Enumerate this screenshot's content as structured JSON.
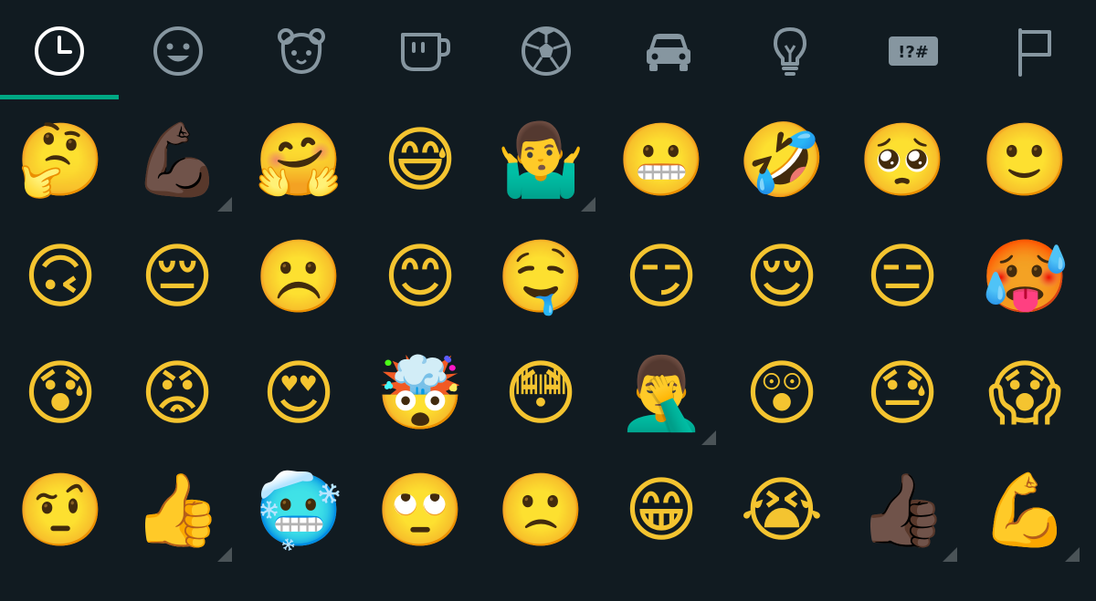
{
  "colors": {
    "background": "#111b21",
    "icon": "#8696a0",
    "accent": "#00a884"
  },
  "tabs": [
    {
      "icon": "clock-icon",
      "name": "recent",
      "active": true
    },
    {
      "icon": "smiley-icon",
      "name": "smileys-people",
      "active": false
    },
    {
      "icon": "bear-icon",
      "name": "animals-nature",
      "active": false
    },
    {
      "icon": "cup-icon",
      "name": "food-drink",
      "active": false
    },
    {
      "icon": "soccer-ball-icon",
      "name": "activity",
      "active": false
    },
    {
      "icon": "car-icon",
      "name": "travel-places",
      "active": false
    },
    {
      "icon": "lightbulb-icon",
      "name": "objects",
      "active": false
    },
    {
      "icon": "symbols-icon",
      "name": "symbols",
      "active": false,
      "label": "!?#"
    },
    {
      "icon": "flag-icon",
      "name": "flags",
      "active": false
    }
  ],
  "emoji_rows": [
    [
      {
        "char": "🤔",
        "name": "thinking-face",
        "variant": false
      },
      {
        "char": "💪🏿",
        "name": "flexed-biceps-dark",
        "variant": true
      },
      {
        "char": "🤗",
        "name": "hugging-face",
        "variant": false
      },
      {
        "char": "😅",
        "name": "grinning-face-with-sweat",
        "variant": false
      },
      {
        "char": "🤷‍♂️",
        "name": "man-shrugging",
        "variant": true
      },
      {
        "char": "😬",
        "name": "grimacing-face",
        "variant": false
      },
      {
        "char": "🤣",
        "name": "rolling-on-floor-laughing",
        "variant": false
      },
      {
        "char": "🥺",
        "name": "pleading-face",
        "variant": false
      },
      {
        "char": "🙂",
        "name": "slightly-smiling-face",
        "variant": false
      }
    ],
    [
      {
        "char": "🙃",
        "name": "upside-down-face",
        "variant": false
      },
      {
        "char": "😔",
        "name": "pensive-face",
        "variant": false
      },
      {
        "char": "☹️",
        "name": "frowning-face",
        "variant": false
      },
      {
        "char": "😊",
        "name": "smiling-face-with-smiling-eyes",
        "variant": false
      },
      {
        "char": "🤤",
        "name": "drooling-face",
        "variant": false
      },
      {
        "char": "😏",
        "name": "smirking-face",
        "variant": false
      },
      {
        "char": "😌",
        "name": "relieved-face",
        "variant": false
      },
      {
        "char": "😑",
        "name": "expressionless-face",
        "variant": false
      },
      {
        "char": "🥵",
        "name": "hot-face",
        "variant": false
      }
    ],
    [
      {
        "char": "😰",
        "name": "anxious-face-with-sweat",
        "variant": false
      },
      {
        "char": "😡",
        "name": "pouting-face",
        "variant": false
      },
      {
        "char": "😍",
        "name": "smiling-face-with-heart-eyes",
        "variant": false
      },
      {
        "char": "🤯",
        "name": "exploding-head",
        "variant": false
      },
      {
        "char": "😳",
        "name": "flushed-face",
        "variant": false
      },
      {
        "char": "🤦‍♂️",
        "name": "man-facepalming",
        "variant": true
      },
      {
        "char": "😲",
        "name": "astonished-face",
        "variant": false
      },
      {
        "char": "😓",
        "name": "downcast-face-with-sweat",
        "variant": false
      },
      {
        "char": "😱",
        "name": "face-screaming-in-fear",
        "variant": false
      }
    ],
    [
      {
        "char": "🤨",
        "name": "face-with-raised-eyebrow",
        "variant": false
      },
      {
        "char": "👍",
        "name": "thumbs-up",
        "variant": true
      },
      {
        "char": "🥶",
        "name": "cold-face",
        "variant": false
      },
      {
        "char": "🙄",
        "name": "face-with-rolling-eyes",
        "variant": false
      },
      {
        "char": "🙁",
        "name": "slightly-frowning-face",
        "variant": false
      },
      {
        "char": "😁",
        "name": "beaming-face-with-smiling-eyes",
        "variant": false
      },
      {
        "char": "😭",
        "name": "loudly-crying-face",
        "variant": false
      },
      {
        "char": "👍🏿",
        "name": "thumbs-up-dark",
        "variant": true
      },
      {
        "char": "💪",
        "name": "flexed-biceps",
        "variant": true
      }
    ]
  ]
}
